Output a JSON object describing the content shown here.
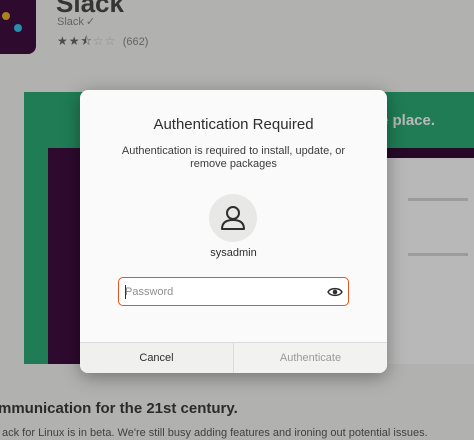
{
  "background_app": {
    "title": "Slack",
    "developer": "Slack",
    "rating_count": "(662)",
    "rating_value": 2.5,
    "rating_max": 5,
    "banner": "e place.",
    "tagline": "mmunication for the 21st century.",
    "sub_tagline": "ack for Linux is in beta. We're still busy adding features and ironing out potential issues."
  },
  "dialog": {
    "title": "Authentication Required",
    "message": "Authentication is required to install, update, or remove packages",
    "avatar_icon": "user-icon",
    "username": "sysadmin",
    "password": {
      "placeholder": "Password",
      "value": "",
      "reveal_icon": "eye-icon"
    },
    "buttons": {
      "cancel": "Cancel",
      "authenticate": "Authenticate"
    }
  },
  "colors": {
    "focus_accent": "#e95420",
    "background_card": "#2bac76",
    "slack_aubergine": "#3f0e40"
  }
}
